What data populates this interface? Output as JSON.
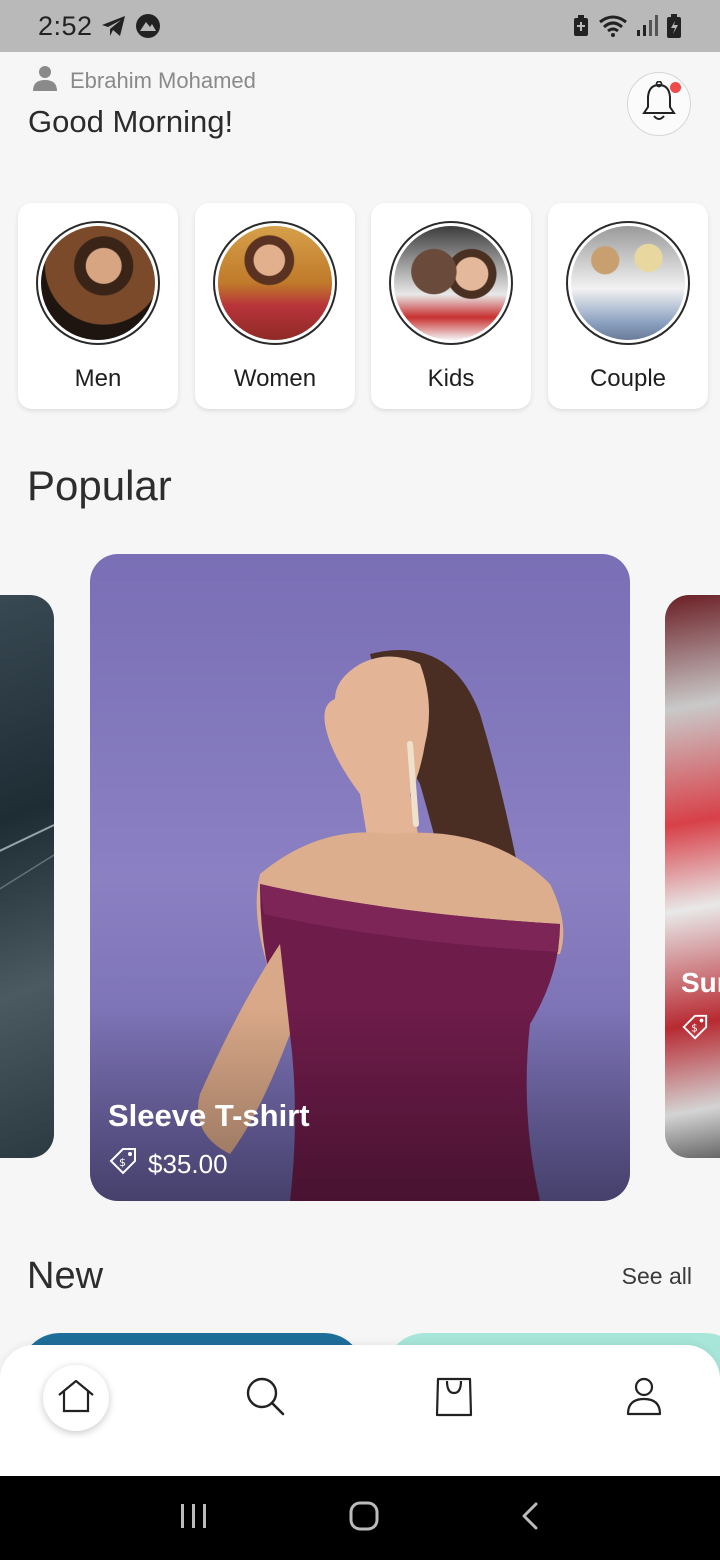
{
  "status_bar": {
    "time": "2:52",
    "left_icons": [
      "telegram-icon",
      "app-icon"
    ],
    "right_icons": [
      "battery-saver-icon",
      "wifi-icon",
      "signal-icon",
      "battery-icon"
    ]
  },
  "header": {
    "user_icon": "person-icon",
    "user_name": "Ebrahim Mohamed",
    "greeting": "Good Morning!",
    "notification_icon": "bell-icon",
    "notification_dot_color": "#ef4b4b"
  },
  "categories": [
    {
      "label": "Men"
    },
    {
      "label": "Women"
    },
    {
      "label": "Kids"
    },
    {
      "label": "Couple"
    }
  ],
  "popular": {
    "title": "Popular",
    "main_item": {
      "name": "Sleeve T-shirt",
      "price": "$35.00",
      "price_icon": "price-tag-icon"
    },
    "right_item": {
      "name_partial": "Sur"
    }
  },
  "new_section": {
    "title": "New",
    "see_all": "See all"
  },
  "bottom_nav": {
    "items": [
      {
        "icon": "home-icon",
        "active": true
      },
      {
        "icon": "search-icon",
        "active": false
      },
      {
        "icon": "shopping-bag-icon",
        "active": false
      },
      {
        "icon": "profile-icon",
        "active": false
      }
    ]
  },
  "system_nav": [
    "recents-icon",
    "home-circle-icon",
    "back-icon"
  ]
}
